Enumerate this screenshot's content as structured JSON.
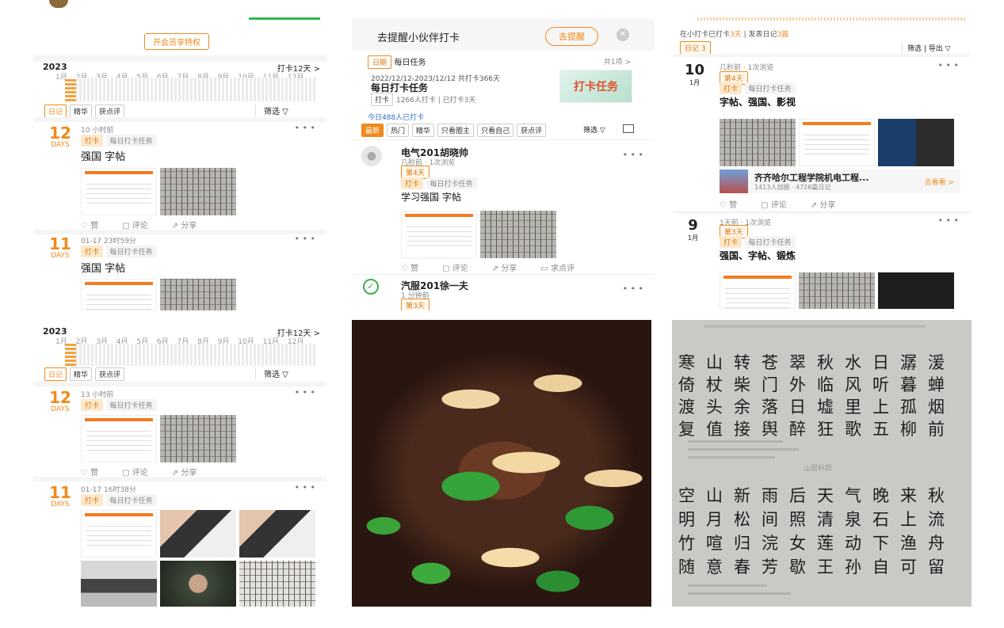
{
  "p1": {
    "member_btn": "开会员享特权",
    "year": "2023",
    "streak": "打卡12天 >",
    "months": "1月 2月 3月 4月 5月 6月 7月 8月 9月 10月 11月 12月",
    "tabs": [
      "日记",
      "精华",
      "获点评"
    ],
    "filter": "筛选 ▽",
    "e1": {
      "day": "12",
      "days": "DAYS",
      "time": "10 小时前",
      "tag": "打卡",
      "task": "每日打卡任务",
      "title": "强国 字帖",
      "like": "赞",
      "comment": "评论",
      "share": "分享"
    },
    "e2": {
      "day": "11",
      "days": "DAYS",
      "time": "01-17 23时59分",
      "tag": "打卡",
      "task": "每日打卡任务",
      "title": "强国 字帖"
    }
  },
  "p2": {
    "remind_text": "去提醒小伙伴打卡",
    "remind_btn": "去提醒",
    "daily_label": "日期",
    "daily_task": "每日任务",
    "count": "共1项 >",
    "range": "2022/12/12-2023/12/12 共打卡366天",
    "task_title": "每日打卡任务",
    "task_stats": "1266人打卡 | 已打卡3天",
    "task_badge": "打卡",
    "banner": "打卡任务",
    "today": "今日488人已打卡",
    "chips": [
      "最新",
      "热门",
      "精华",
      "只看圈主",
      "只看自己",
      "获点评"
    ],
    "filter": "筛选 ▽",
    "u1": {
      "name": "电气201胡晓帅",
      "time": "几秒前 · 1次浏览",
      "day": "第4天",
      "tag": "打卡",
      "task": "每日打卡任务",
      "title": "学习强国 字帖",
      "like": "赞",
      "comment": "评论",
      "share": "分享",
      "ask": "求点评"
    },
    "u2": {
      "name": "汽服201徐一夫",
      "time": "1 分钟前",
      "day": "第3天"
    }
  },
  "p3": {
    "summary_a": "在小打卡已打卡",
    "summary_days": "3天",
    "summary_b": "| 发表日记",
    "summary_cnt": "3篇",
    "diary_tag": "日记 3",
    "tools": "筛选 | 导出 ▽",
    "e1": {
      "day": "10",
      "month": "1月",
      "time": "几秒前 · 1次浏览",
      "badge": "第4天",
      "tag": "打卡",
      "task": "每日打卡任务",
      "title": "字帖、强国、影视",
      "group": "齐齐哈尔工程学院机电工程...",
      "group_sub": "1413人加圈 · 4726篇日记",
      "group_btn": "去看看 >",
      "like": "赞",
      "comment": "评论",
      "share": "分享"
    },
    "e2": {
      "day": "9",
      "month": "1月",
      "time": "1天前 · 1次浏览",
      "badge": "第3天",
      "tag": "打卡",
      "task": "每日打卡任务",
      "title": "强国、字帖、锻炼"
    }
  },
  "p4": {
    "year": "2023",
    "streak": "打卡12天 >",
    "months": "1月 2月 3月 4月 5月 6月 7月 8月 9月 10月 11月 12月",
    "tabs": [
      "日记",
      "精华",
      "获点评"
    ],
    "filter": "筛选 ▽",
    "e1": {
      "day": "12",
      "days": "DAYS",
      "time": "13 小时前",
      "tag": "打卡",
      "task": "每日打卡任务",
      "like": "赞",
      "comment": "评论",
      "share": "分享"
    },
    "e2": {
      "day": "11",
      "days": "DAYS",
      "time": "01-17 16时38分",
      "tag": "打卡",
      "task": "每日打卡任务"
    }
  },
  "p6": {
    "rows": [
      "寒山转苍翠秋水日潺湲",
      "倚杖柴门外临风听暮蝉",
      "渡头余落日墟里上孤烟",
      "复值接舆醉狂歌五柳前",
      "空山新雨后天气晚来秋",
      "明月松间照清泉石上流",
      "竹喧归浣女莲动下渔舟",
      "随意春芳歇王孙自可留"
    ],
    "heading": "山居秋暝"
  }
}
